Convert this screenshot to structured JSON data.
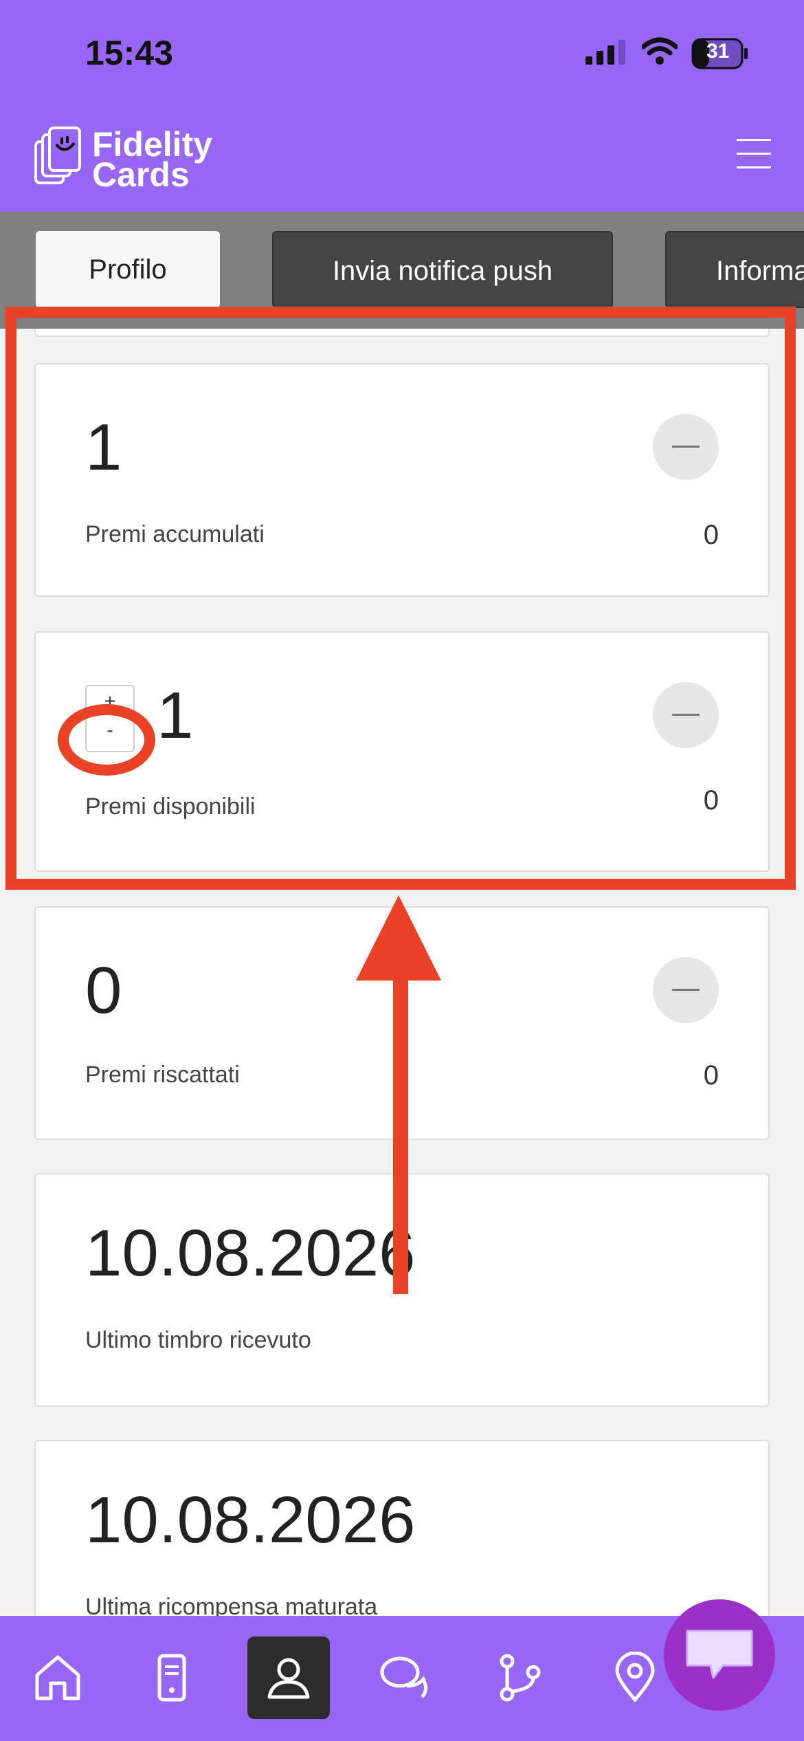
{
  "status_bar": {
    "time": "15:43",
    "battery": "31",
    "icons": [
      "signal-icon",
      "wifi-icon",
      "battery-icon"
    ]
  },
  "header": {
    "logo_line1": "Fidelity",
    "logo_line2": "Cards",
    "menu_icon": "hamburger-menu-icon"
  },
  "tabs": [
    {
      "label": "Profilo",
      "active": true
    },
    {
      "label": "Invia notifica push",
      "active": false
    },
    {
      "label": "Informa",
      "active": false
    }
  ],
  "cards": [
    {
      "value": "1",
      "label": "Premi accumulati",
      "count": "0"
    },
    {
      "value": "1",
      "label": "Premi disponibili",
      "count": "0",
      "stepper_plus": "+",
      "stepper_minus": "-"
    },
    {
      "value": "0",
      "label": "Premi riscattati",
      "count": "0"
    },
    {
      "value": "10.08.2026",
      "label": "Ultimo timbro ricevuto"
    },
    {
      "value": "10.08.2026",
      "label": "Ultima ricompensa maturata"
    }
  ],
  "bottom_nav": [
    {
      "icon": "home-icon"
    },
    {
      "icon": "device-icon"
    },
    {
      "icon": "profile-icon",
      "active": true
    },
    {
      "icon": "chat-icon"
    },
    {
      "icon": "branch-icon"
    },
    {
      "icon": "location-pin-icon"
    }
  ],
  "colors": {
    "brand": "#9766f4",
    "annotation": "#ea4226",
    "tab_dark": "#444444",
    "fab": "#9b30c8"
  }
}
